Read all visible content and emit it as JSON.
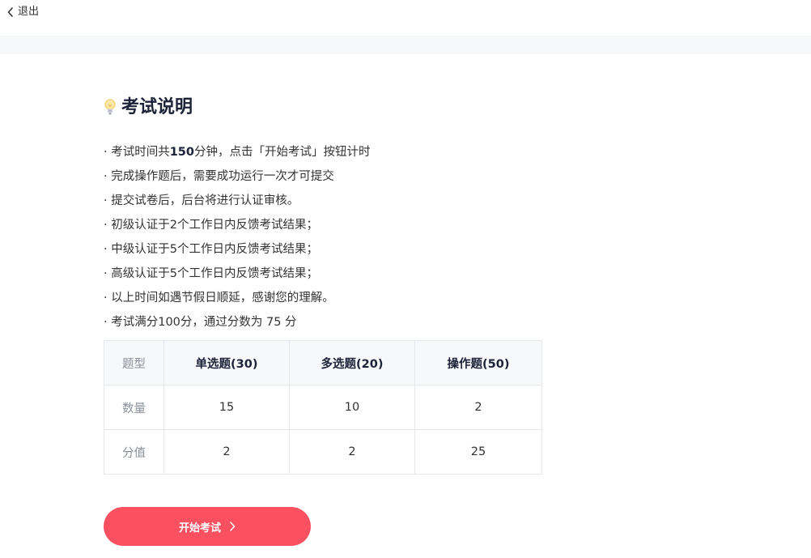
{
  "header": {
    "back_label": "退出",
    "back_icon": "chevron-left-icon"
  },
  "instructions": {
    "title": "考试说明",
    "title_icon": "lightbulb-icon",
    "items": [
      {
        "before": "· 考试时间共",
        "bold": "150",
        "after": "分钟，点击「开始考试」按钮计时"
      },
      {
        "text": "· 完成操作题后，需要成功运行一次才可提交"
      },
      {
        "text": "· 提交试卷后，后台将进行认证审核。"
      },
      {
        "text": "· 初级认证于2个工作日内反馈考试结果；"
      },
      {
        "text": "· 中级认证于5个工作日内反馈考试结果；"
      },
      {
        "text": "· 高级认证于5个工作日内反馈考试结果；"
      },
      {
        "text": "· 以上时间如遇节假日顺延，感谢您的理解。"
      },
      {
        "text": "· 考试满分100分，通过分数为 75 分"
      }
    ]
  },
  "table": {
    "header_label": "题型",
    "columns": [
      "单选题(30)",
      "多选题(20)",
      "操作题(50)"
    ],
    "rows": [
      {
        "label": "数量",
        "values": [
          "15",
          "10",
          "2"
        ]
      },
      {
        "label": "分值",
        "values": [
          "2",
          "2",
          "25"
        ]
      }
    ]
  },
  "start_button": {
    "label": "开始考试",
    "icon": "chevron-right-icon"
  },
  "colors": {
    "accent": "#fb5060",
    "title": "#1c2238",
    "muted": "#8a8f99",
    "band": "#f7f8fa"
  }
}
